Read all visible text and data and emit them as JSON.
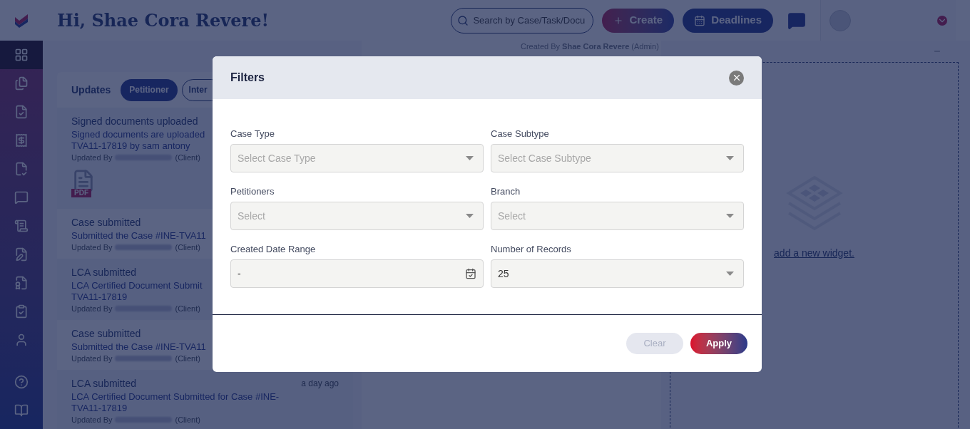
{
  "header": {
    "greeting": "Hi, Shae Cora Revere!",
    "search": {
      "placeholder": "Search by Case/Task/Docu"
    },
    "create_button": "Create",
    "deadlines_button": "Deadlines"
  },
  "sidebar": {
    "items": [
      {
        "selected": true
      },
      {
        "selected": false
      },
      {
        "selected": false
      },
      {
        "selected": false
      },
      {
        "selected": false
      },
      {
        "selected": false
      },
      {
        "selected": false
      },
      {
        "selected": false
      },
      {
        "selected": false
      },
      {
        "selected": false
      },
      {
        "selected": false
      }
    ]
  },
  "updates": {
    "title": "Updates",
    "tabs": [
      {
        "label": "Petitioner",
        "selected": true
      },
      {
        "label": "Inter",
        "selected": false
      }
    ],
    "items": [
      {
        "title": "Signed documents uploaded",
        "lines": [
          "Signed documents are uploaded",
          "TVA11-17819 by sam antony"
        ],
        "updated_by": "Updated By",
        "role": "(Client)",
        "attachment": "PDF"
      },
      {
        "title": "Case submitted",
        "lines": [
          "Submitted the Case #INE-TVA11"
        ],
        "updated_by": "Updated By",
        "role": "(Client)"
      },
      {
        "title": "LCA submitted",
        "lines": [
          "LCA Certified Document Submit",
          "TVA11-17819"
        ],
        "updated_by": "Updated By",
        "role": "(Client)"
      },
      {
        "title": "Case submitted",
        "lines": [
          "Submitted the Case #INE-TVA11"
        ],
        "updated_by": "Updated By",
        "role": "(Client)"
      },
      {
        "title": "LCA submitted",
        "time": "a day ago",
        "lines": [
          "LCA Certified Document Submitted for Case #INE-",
          "TVA11-17819"
        ],
        "updated_by": "Updated By",
        "role": "(Client)"
      }
    ]
  },
  "activity": {
    "created_by": "Created By **Shae Cora Revere** (Admin)"
  },
  "widget_area": {
    "link": "add a new widget."
  },
  "modal": {
    "title": "Filters",
    "fields": [
      {
        "label": "Case Type",
        "kind": "select",
        "placeholder": "Select Case Type"
      },
      {
        "label": "Case Subtype",
        "kind": "select",
        "placeholder": "Select Case Subtype"
      },
      {
        "label": "Petitioners",
        "kind": "select",
        "placeholder": "Select"
      },
      {
        "label": "Branch",
        "kind": "select",
        "placeholder": "Select"
      },
      {
        "label": "Created Date Range",
        "kind": "date",
        "value": "-"
      },
      {
        "label": "Number of Records",
        "kind": "select",
        "value": "25"
      }
    ],
    "buttons": [
      {
        "label": "Clear",
        "kind": "secondary",
        "disabled": true
      },
      {
        "label": "Apply",
        "kind": "primary",
        "disabled": false
      }
    ]
  }
}
